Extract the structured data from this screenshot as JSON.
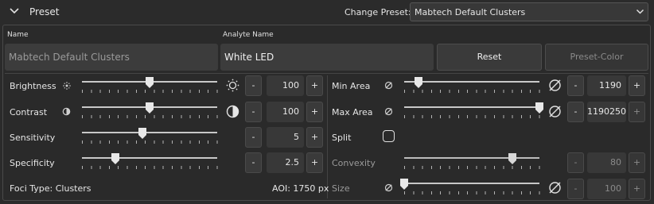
{
  "header": {
    "title": "Preset",
    "change_preset_label": "Change Preset:",
    "preset_selected": "Mabtech Default Clusters"
  },
  "fields": {
    "name_label": "Name",
    "name_value": "Mabtech Default Clusters",
    "analyte_label": "Analyte Name",
    "analyte_value": "White LED",
    "reset_label": "Reset",
    "preset_color_label": "Preset-Color"
  },
  "left": {
    "rows": [
      {
        "label": "Brightness",
        "value": "100",
        "minus": "-",
        "plus": "+"
      },
      {
        "label": "Contrast",
        "value": "100",
        "minus": "-",
        "plus": "+"
      },
      {
        "label": "Sensitivity",
        "value": "5",
        "minus": "-",
        "plus": "+"
      },
      {
        "label": "Specificity",
        "value": "2.5",
        "minus": "-",
        "plus": "+"
      }
    ],
    "foci_type": "Foci Type: Clusters",
    "aoi": "AOI: 1750 px"
  },
  "right": {
    "rows": [
      {
        "label": "Min Area",
        "value": "1190",
        "minus": "-",
        "plus": "+"
      },
      {
        "label": "Max Area",
        "value": "1190250",
        "minus": "-",
        "plus": "+"
      },
      {
        "label": "Split"
      },
      {
        "label": "Convexity",
        "value": "80",
        "minus": "-",
        "plus": "+"
      },
      {
        "label": "Size",
        "value": "100",
        "minus": "-",
        "plus": "+"
      }
    ]
  },
  "colors": {
    "background": "#2b2b2b",
    "field": "#3c3c3c",
    "button": "#3a3a3a"
  }
}
